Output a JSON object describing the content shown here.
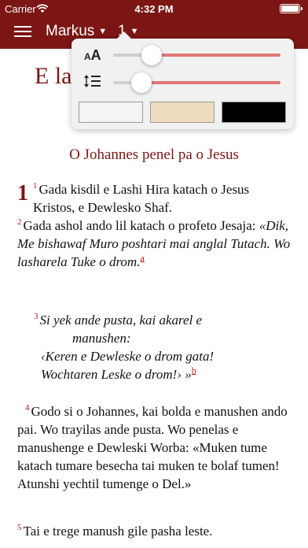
{
  "status": {
    "carrier": "Carrier",
    "time": "4:32 PM"
  },
  "nav": {
    "book": "Markus",
    "chapter": "1"
  },
  "settings": {
    "font_size_level": 0.23,
    "line_spacing_level": 0.17,
    "themes": [
      {
        "name": "light",
        "color": "#f4f4f4"
      },
      {
        "name": "sepia",
        "color": "#efdcbc"
      },
      {
        "name": "dark",
        "color": "#000000"
      }
    ]
  },
  "content": {
    "chapter_heading_visible": "E la",
    "section_title": "O Johannes penel pa o Jesus",
    "verses": {
      "v1_num": "1",
      "v1_text": "Gada kisdil e Lashi Hira katach o Jesus Kristos, e Dewlesko Shaf.",
      "v2_num": "2",
      "v2_text": "Gada ashol ando lil katach o profeto Jesaja: ",
      "v2_quote": "«Dik, Me bishawaf Muro poshtari mai anglal Tutach. Wo lasharela Tuke o drom.",
      "v2_note": "a",
      "v3_num": "3",
      "v3_line1": "Si yek ande pusta, kai akarel e",
      "v3_line2": "manushen:",
      "v3_line3": "‹Keren e Dewleske o drom gata!",
      "v3_line4": "Wochtaren Leske o drom!› »",
      "v3_note": "b",
      "v4_num": "4",
      "v4_text": "Godo si o Johannes, kai bolda e manushen ando pai. Wo trayilas ande pusta. Wo penelas e manushenge e Dewleski Worba: «Muken tume katach tumare besecha tai muken te bolaf tumen! Atunshi yechtil tumenge o Del.»",
      "v5_num": "5",
      "v5_text": "Tai e trege manush gile pasha leste."
    }
  }
}
